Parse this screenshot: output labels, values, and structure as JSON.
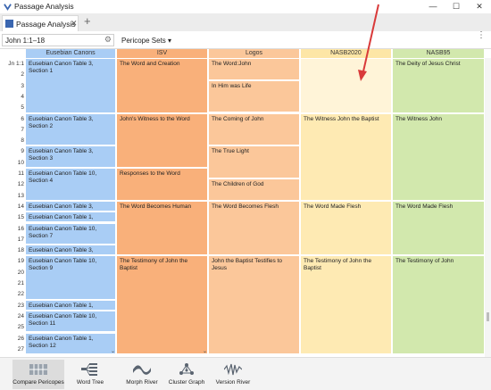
{
  "window": {
    "title": "Passage Analysis",
    "controls": {
      "minimize": "—",
      "maximize": "☐",
      "close": "✕"
    }
  },
  "tabs": [
    {
      "label": "Passage Analysis",
      "close": "✕"
    }
  ],
  "new_tab": "+",
  "toolbar": {
    "reference_value": "John 1:1–18",
    "pericope_sets_label": "Pericope Sets",
    "more_menu": "⋮"
  },
  "columns": [
    {
      "id": "euseb",
      "label": "Eusebian Canons",
      "color": "#a9cdf5"
    },
    {
      "id": "isv",
      "label": "ISV",
      "color": "#f9b07a"
    },
    {
      "id": "logos",
      "label": "Logos",
      "color": "#fbc79a"
    },
    {
      "id": "nasb20",
      "label": "NASB2020",
      "color": "#feeab3"
    },
    {
      "id": "nasb95",
      "label": "NASB95",
      "color": "#d2e8ad"
    }
  ],
  "verse_numbers": [
    "Jn 1:1",
    "2",
    "3",
    "4",
    "5",
    "6",
    "7",
    "8",
    "9",
    "10",
    "11",
    "12",
    "13",
    "14",
    "15",
    "16",
    "17",
    "18",
    "19",
    "20",
    "21",
    "22",
    "23",
    "24",
    "25",
    "26",
    "27"
  ],
  "pericopes": {
    "euseb": [
      {
        "label": "Eusebian Canon Table 3, Section 1",
        "from": 1,
        "to": 5
      },
      {
        "label": "Eusebian Canon Table 3, Section 2",
        "from": 6,
        "to": 8
      },
      {
        "label": "Eusebian Canon Table 3, Section 3",
        "from": 9,
        "to": 10
      },
      {
        "label": "Eusebian Canon Table 10, Section 4",
        "from": 11,
        "to": 13
      },
      {
        "label": "Eusebian Canon Table 3, Section 5",
        "from": 14,
        "to": 14
      },
      {
        "label": "Eusebian Canon Table 1, Section 6",
        "from": 15,
        "to": 15
      },
      {
        "label": "Eusebian Canon Table 10, Section 7",
        "from": 16,
        "to": 17
      },
      {
        "label": "Eusebian Canon Table 3, Section 8",
        "from": 18,
        "to": 18
      },
      {
        "label": "Eusebian Canon Table 10, Section 9",
        "from": 19,
        "to": 22
      },
      {
        "label": "Eusebian Canon Table 1, Section 10",
        "from": 23,
        "to": 23
      },
      {
        "label": "Eusebian Canon Table 10, Section 11",
        "from": 24,
        "to": 25
      },
      {
        "label": "Eusebian Canon Table 1, Section 12",
        "from": 26,
        "to": 27
      }
    ],
    "isv": [
      {
        "label": "The Word and Creation",
        "from": 1,
        "to": 5
      },
      {
        "label": "John's Witness to the Word",
        "from": 6,
        "to": 10
      },
      {
        "label": "Responses to the Word",
        "from": 11,
        "to": 13
      },
      {
        "label": "The Word Becomes Human",
        "from": 14,
        "to": 18
      },
      {
        "label": "The Testimony of John the Baptist",
        "from": 19,
        "to": 27
      }
    ],
    "logos": [
      {
        "label": "The Word:John",
        "from": 1,
        "to": 2
      },
      {
        "label": "In Him was Life",
        "from": 3,
        "to": 5
      },
      {
        "label": "The Coming of John",
        "from": 6,
        "to": 8
      },
      {
        "label": "The True Light",
        "from": 9,
        "to": 11
      },
      {
        "label": "The Children of God",
        "from": 12,
        "to": 13
      },
      {
        "label": "The Word Becomes Flesh",
        "from": 14,
        "to": 18
      },
      {
        "label": "John the Baptist Testifies to Jesus",
        "from": 19,
        "to": 27
      }
    ],
    "nasb20": [
      {
        "label": "",
        "from": 1,
        "to": 5,
        "selected": true
      },
      {
        "label": "The Witness John the Baptist",
        "from": 6,
        "to": 13
      },
      {
        "label": "The Word Made Flesh",
        "from": 14,
        "to": 18
      },
      {
        "label": "The Testimony of John the Baptist",
        "from": 19,
        "to": 27
      }
    ],
    "nasb95": [
      {
        "label": "The Deity of Jesus Christ",
        "from": 1,
        "to": 5
      },
      {
        "label": "The Witness John",
        "from": 6,
        "to": 13
      },
      {
        "label": "The Word Made Flesh",
        "from": 14,
        "to": 18
      },
      {
        "label": "The Testimony of John",
        "from": 19,
        "to": 27
      }
    ]
  },
  "bottom_tools": [
    {
      "label": "Compare Pericopes",
      "icon": "compare-pericopes-icon",
      "active": true
    },
    {
      "label": "Word Tree",
      "icon": "word-tree-icon",
      "active": false
    },
    {
      "label": "Morph River",
      "icon": "morph-river-icon",
      "active": false
    },
    {
      "label": "Cluster Graph",
      "icon": "cluster-graph-icon",
      "active": false
    },
    {
      "label": "Version River",
      "icon": "version-river-icon",
      "active": false
    }
  ],
  "annotation_arrow_color": "#d93a3a"
}
